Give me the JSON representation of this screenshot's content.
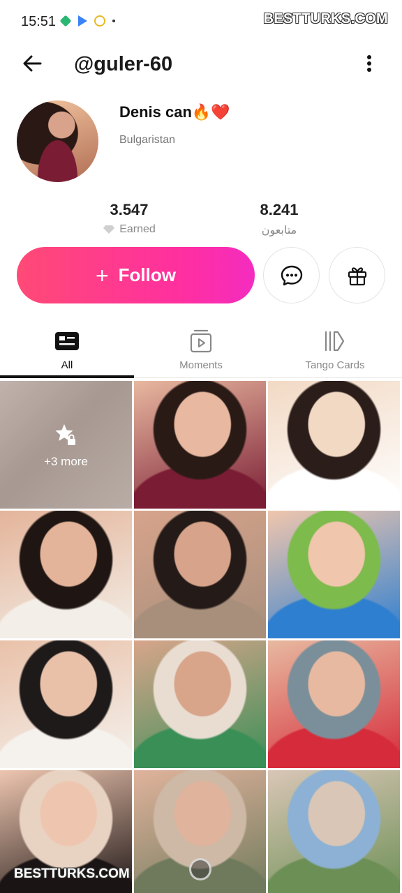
{
  "status_bar": {
    "time": "15:51",
    "watermark": "BESTTURKS.COM"
  },
  "header": {
    "username": "@guler-60"
  },
  "profile": {
    "display_name": "Denis can🔥❤️",
    "country": "Bulgaristan"
  },
  "stats": {
    "earned_value": "3.547",
    "earned_label": "Earned",
    "followers_value": "8.241",
    "followers_label": "متابعون"
  },
  "actions": {
    "follow_label": "Follow"
  },
  "tabs": [
    {
      "label": "All",
      "icon": "profile-card-icon",
      "active": true
    },
    {
      "label": "Moments",
      "icon": "video-play-icon",
      "active": false
    },
    {
      "label": "Tango Cards",
      "icon": "cards-icon",
      "active": false
    }
  ],
  "grid": {
    "locked_more_text": "+3 more",
    "photos": [
      {
        "colors": [
          "#e8b8a0",
          "#7a1d34",
          "#2a1a16"
        ]
      },
      {
        "colors": [
          "#f2d9c4",
          "#ffffff",
          "#2b1d1a"
        ]
      },
      {
        "colors": [
          "#e4b49a",
          "#f3efe8",
          "#1f1613"
        ]
      },
      {
        "colors": [
          "#d7a38b",
          "#a78f7c",
          "#241a17"
        ]
      },
      {
        "colors": [
          "#f0c6ad",
          "#2f7fd0",
          "#7dbb4c"
        ]
      },
      {
        "colors": [
          "#e9c1a9",
          "#f5f2ee",
          "#1e1a1a"
        ]
      },
      {
        "colors": [
          "#d8a58b",
          "#3a8f57",
          "#e9ddd2"
        ]
      },
      {
        "colors": [
          "#e7b9a0",
          "#d62b3a",
          "#7a8f9a"
        ]
      },
      {
        "colors": [
          "#eec6b0",
          "#1b1414",
          "#e8d3c2"
        ]
      },
      {
        "colors": [
          "#e0b39c",
          "#6f7a5c",
          "#cdb9a6"
        ]
      },
      {
        "colors": [
          "#d9c6b6",
          "#6c8f55",
          "#8cb1d4"
        ]
      }
    ]
  },
  "watermark_bottom": "BESTTURKS.COM"
}
